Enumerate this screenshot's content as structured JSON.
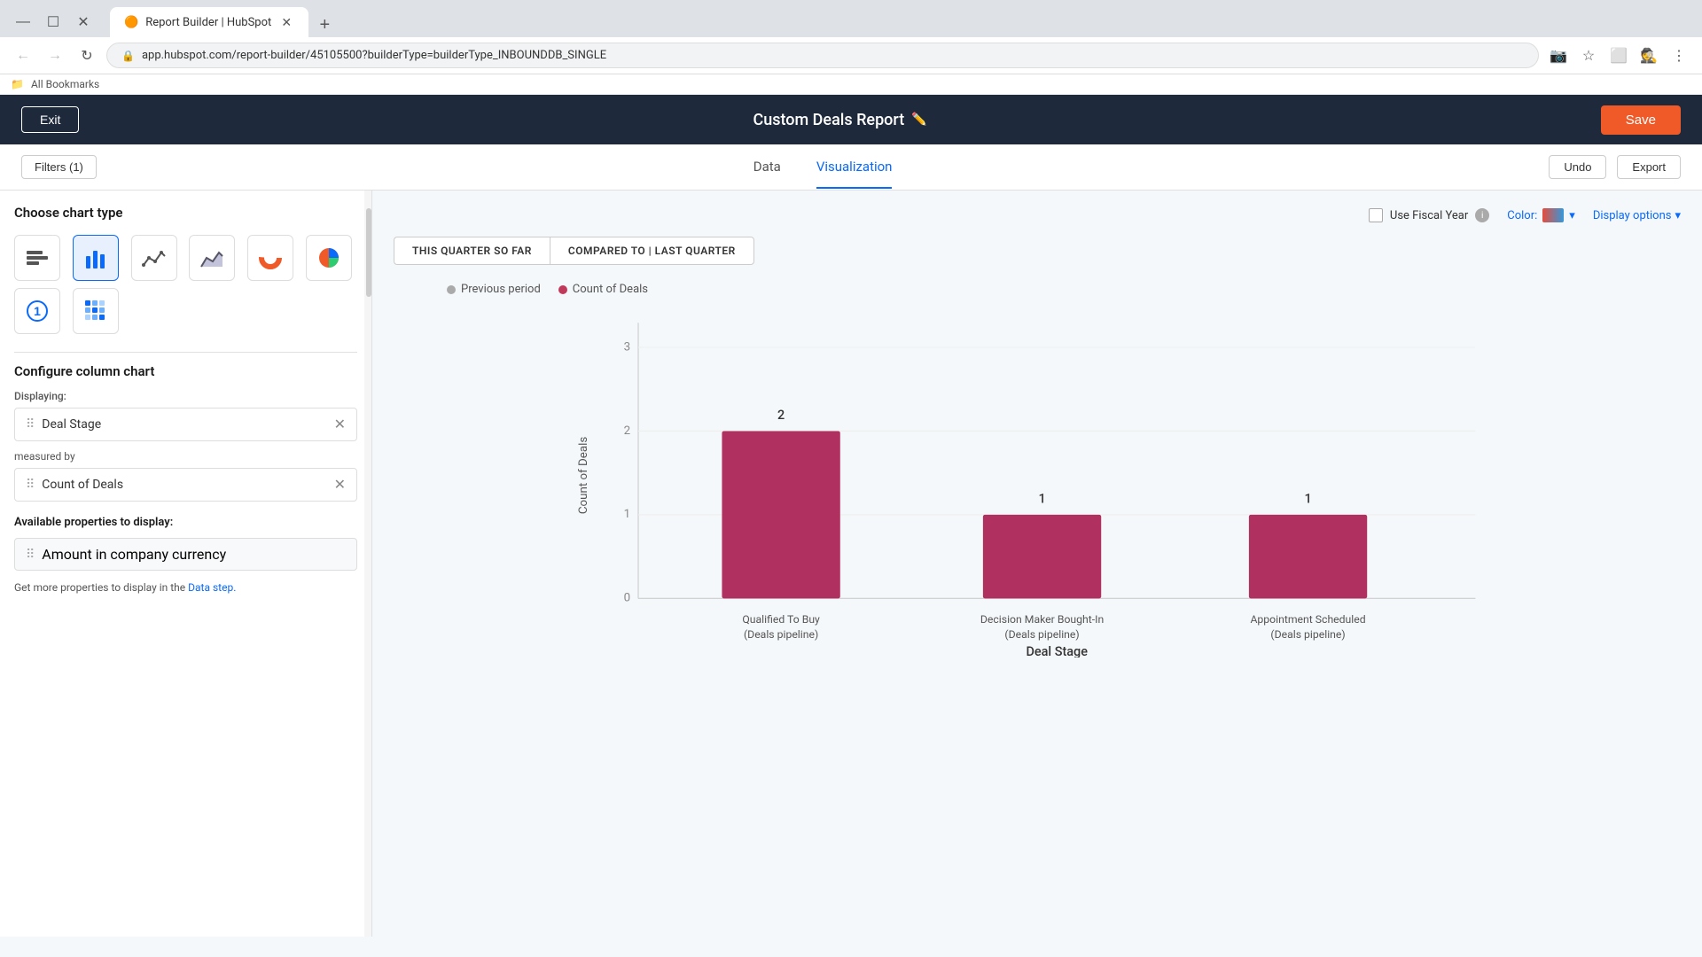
{
  "browser": {
    "tab_title": "Report Builder | HubSpot",
    "tab_favicon": "🟠",
    "address": "app.hubspot.com/report-builder/45105500?builderType=builderType_INBOUNDDB_SINGLE",
    "new_tab_label": "+",
    "incognito_label": "Incognito",
    "bookmarks_label": "All Bookmarks"
  },
  "app": {
    "exit_label": "Exit",
    "title": "Custom Deals Report",
    "save_label": "Save",
    "filters_label": "Filters (1)",
    "tab_data": "Data",
    "tab_visualization": "Visualization",
    "undo_label": "Undo",
    "export_label": "Export"
  },
  "sidebar": {
    "chart_type_title": "Choose chart type",
    "chart_types": [
      {
        "name": "bar-horizontal-icon",
        "symbol": "☰",
        "label": "Horizontal Bar"
      },
      {
        "name": "bar-vertical-icon",
        "symbol": "📊",
        "label": "Vertical Bar",
        "active": true
      },
      {
        "name": "line-icon",
        "symbol": "📈",
        "label": "Line"
      },
      {
        "name": "area-icon",
        "symbol": "▲",
        "label": "Area"
      },
      {
        "name": "donut-icon",
        "symbol": "◉",
        "label": "Donut"
      },
      {
        "name": "pie-icon",
        "symbol": "◑",
        "label": "Pie"
      },
      {
        "name": "number-icon",
        "symbol": "①",
        "label": "Number"
      },
      {
        "name": "heatmap-icon",
        "symbol": "⊞",
        "label": "Heatmap"
      }
    ],
    "configure_title": "Configure column chart",
    "displaying_label": "Displaying:",
    "deal_stage_item": "Deal Stage",
    "measured_label": "measured by",
    "count_of_deals_item": "Count of Deals",
    "available_title": "Available properties to display:",
    "amount_item": "Amount in company currency",
    "data_step_hint": "Get more properties to display in the",
    "data_step_link": "Data step."
  },
  "chart": {
    "use_fiscal_year_label": "Use Fiscal Year",
    "color_label": "Color:",
    "display_options_label": "Display options",
    "tab_this_quarter": "THIS QUARTER SO FAR",
    "tab_compared": "COMPARED TO | LAST QUARTER",
    "legend_previous": "Previous period",
    "legend_count": "Count of Deals",
    "y_axis_label": "Count of Deals",
    "x_axis_label": "Deal Stage",
    "bars": [
      {
        "label": "Qualified To Buy (Deals pipeline)",
        "value": 2,
        "x": 665
      },
      {
        "label": "Decision Maker Bought-In (Deals pipeline)",
        "value": 1,
        "x": 937
      },
      {
        "label": "Appointment Scheduled (Deals pipeline)",
        "value": 1,
        "x": 1208
      }
    ],
    "y_ticks": [
      "3",
      "2",
      "1",
      "0"
    ]
  }
}
